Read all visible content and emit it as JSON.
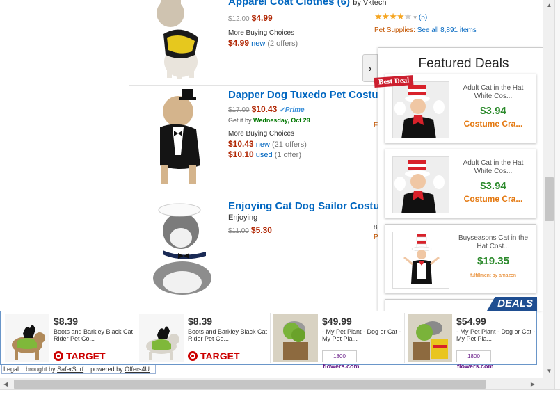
{
  "products": [
    {
      "title": "Apparel Coat Clothes (6)",
      "by": "by Vktech",
      "old_price": "$12.00",
      "price": "$4.99",
      "buying_choices": "More Buying Choices",
      "offer_price": "$4.99",
      "offer_type": "new",
      "offer_count": "(2 offers)",
      "rating_count": "(5)",
      "stars": 4,
      "category_label": "Pet Supplies:",
      "category_link": "See all 8,891 items"
    },
    {
      "title": "Dapper Dog Tuxedo Pet Costume",
      "old_price": "$17.00",
      "price": "$10.43",
      "prime": "✓Prime",
      "get_it": "Get it by",
      "delivery": "Wednesday, Oct 29",
      "buying_choices": "More Buying Choices",
      "offer_price": "$10.43",
      "offer_type": "new",
      "offer_count": "(21 offers)",
      "used_price": "$10.10",
      "used_type": "used",
      "used_count": "(1 offer)",
      "side_mark": "F"
    },
    {
      "title": "Enjoying Cat Dog Sailor Costume",
      "subtitle": "Enjoying",
      "old_price": "$11.00",
      "price": "$5.30",
      "side_mark": "8",
      "side_mark2": "P"
    }
  ],
  "featured_deals": {
    "title": "Featured Deals",
    "badge": "Best Deal",
    "items": [
      {
        "name": "Adult Cat in the Hat White Cos...",
        "price": "$3.94",
        "store": "Costume Cra..."
      },
      {
        "name": "Adult Cat in the Hat White Cos...",
        "price": "$3.94",
        "store": "Costume Cra..."
      },
      {
        "name": "Buyseasons Cat in the Hat Cost...",
        "price": "$19.35",
        "store": "fulfillment by amazon"
      }
    ]
  },
  "ad_bar": {
    "badge": "DEALS",
    "ads": [
      {
        "price": "$8.39",
        "desc": "Boots and Barkley Black Cat Rider Pet Co...",
        "store": "TARGET"
      },
      {
        "price": "$8.39",
        "desc": "Boots and Barkley Black Cat Rider Pet Co...",
        "store": "TARGET"
      },
      {
        "price": "$49.99",
        "desc": "- My Pet Plant - Dog or Cat - My Pet Pla...",
        "store_small": "1800",
        "store_big": "flowers.com"
      },
      {
        "price": "$54.99",
        "desc": "- My Pet Plant - Dog or Cat - My Pet Pla...",
        "store_small": "1800",
        "store_big": "flowers.com"
      }
    ]
  },
  "legal": {
    "prefix": "Legal :: brought by ",
    "brand1": "SaferSurf",
    "middle": " :: powered by ",
    "brand2": "Offers4U"
  },
  "colors": {
    "link": "#0066c0",
    "price": "#b12704",
    "deal_price": "#2c8a2c",
    "store": "#e47911",
    "deals_badge": "#1f4e91",
    "best_deal": "#cc1f2f"
  }
}
